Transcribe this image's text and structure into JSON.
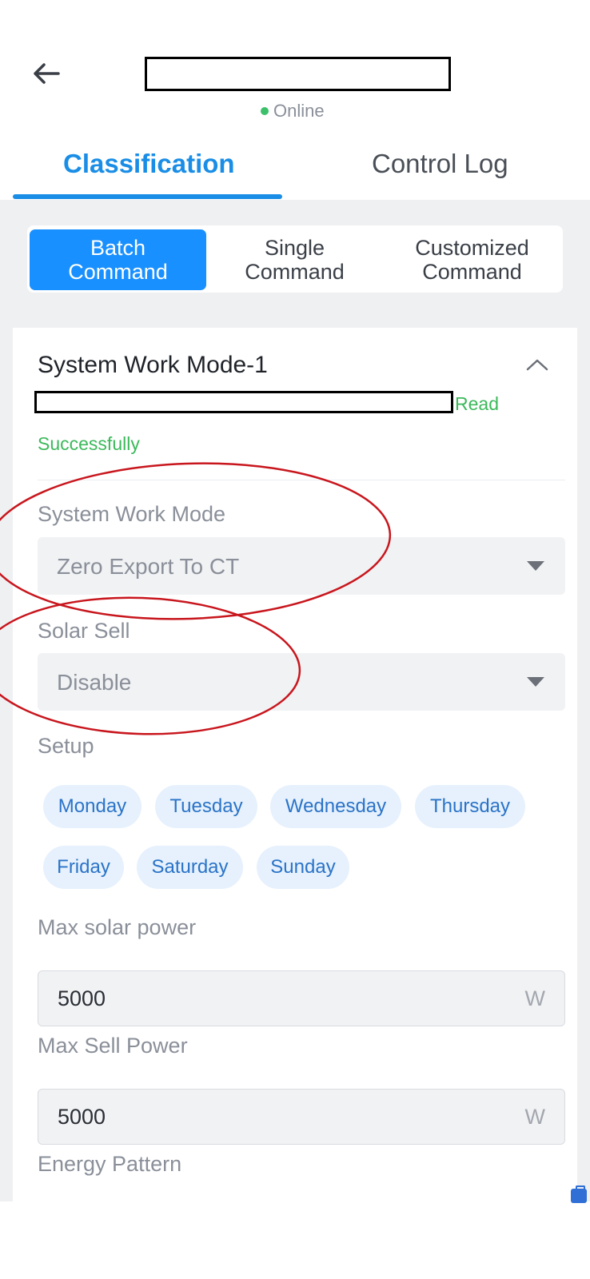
{
  "header": {
    "status_text": "Online",
    "status_color": "#3cc06a",
    "back_icon": "arrow-left-icon"
  },
  "tabs": [
    {
      "label": "Classification",
      "active": true
    },
    {
      "label": "Control Log",
      "active": false
    }
  ],
  "segments": [
    {
      "label": "Batch\nCommand",
      "active": true
    },
    {
      "label": "Single\nCommand",
      "active": false
    },
    {
      "label": "Customized\nCommand",
      "active": false
    }
  ],
  "card": {
    "title": "System Work Mode-1",
    "collapse_icon": "chevron-up-icon",
    "read_status_line1": "Read",
    "read_status_line2": "Successfully",
    "fields": {
      "work_mode": {
        "label": "System Work Mode",
        "value": "Zero Export To CT"
      },
      "solar_sell": {
        "label": "Solar Sell",
        "value": "Disable"
      },
      "setup": {
        "label": "Setup",
        "days": [
          "Monday",
          "Tuesday",
          "Wednesday",
          "Thursday",
          "Friday",
          "Saturday",
          "Sunday"
        ]
      },
      "max_solar_power": {
        "label": "Max solar power",
        "value": "5000",
        "unit": "W"
      },
      "max_sell_power": {
        "label": "Max Sell Power",
        "value": "5000",
        "unit": "W"
      },
      "energy_pattern": {
        "label": "Energy Pattern"
      }
    }
  },
  "colors": {
    "accent": "#1890ff",
    "tab_active": "#1a8ee6",
    "success": "#3cb95b",
    "chip_bg": "#e6f1fd",
    "annotation_red": "#c8161d"
  }
}
